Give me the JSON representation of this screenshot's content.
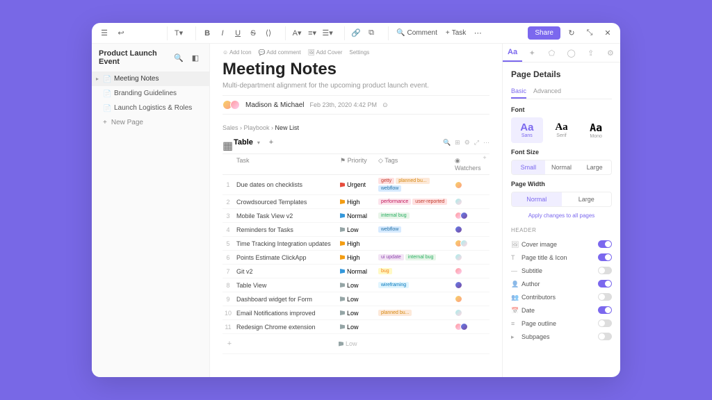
{
  "sidebar": {
    "title": "Product Launch Event",
    "items": [
      {
        "label": "Meeting Notes",
        "active": true
      },
      {
        "label": "Branding Guidelines",
        "active": false
      },
      {
        "label": "Launch Logistics & Roles",
        "active": false
      }
    ],
    "newPage": "New Page"
  },
  "metaActions": {
    "addIcon": "Add Icon",
    "addComment": "Add comment",
    "addCover": "Add Cover",
    "settings": "Settings"
  },
  "page": {
    "title": "Meeting Notes",
    "subtitle": "Multi-department alignment for the upcoming product launch event.",
    "author": "Madison & Michael",
    "date": "Feb 23th, 2020  4:42 PM"
  },
  "breadcrumb": {
    "p1": "Sales",
    "p2": "Playbook",
    "cur": "New List"
  },
  "table": {
    "name": "Table",
    "columns": {
      "task": "Task",
      "priority": "Priority",
      "tags": "Tags",
      "watchers": "Watchers"
    },
    "rows": [
      {
        "n": "1",
        "task": "Due dates on checklists",
        "priority": "Urgent",
        "pclass": "urgent",
        "tags": [
          [
            "getty",
            "getty"
          ],
          [
            "planned",
            "planned bu..."
          ],
          [
            "webflow",
            "webflow"
          ]
        ],
        "w": 1
      },
      {
        "n": "2",
        "task": "Crowdsourced Templates",
        "priority": "High",
        "pclass": "high",
        "tags": [
          [
            "perf",
            "performance"
          ],
          [
            "user-rep",
            "user-reported"
          ]
        ],
        "w": 1
      },
      {
        "n": "3",
        "task": "Mobile Task View v2",
        "priority": "Normal",
        "pclass": "normal",
        "tags": [
          [
            "intbug",
            "internal bug"
          ]
        ],
        "w": 2
      },
      {
        "n": "4",
        "task": "Reminders for Tasks",
        "priority": "Low",
        "pclass": "low",
        "tags": [
          [
            "webflow",
            "webflow"
          ]
        ],
        "w": 1
      },
      {
        "n": "5",
        "task": "Time Tracking Integration updates",
        "priority": "High",
        "pclass": "high",
        "tags": [],
        "w": 2
      },
      {
        "n": "6",
        "task": "Points Estimate ClickApp",
        "priority": "High",
        "pclass": "high",
        "tags": [
          [
            "uiup",
            "ui update"
          ],
          [
            "intbug",
            "internal bug"
          ]
        ],
        "w": 1
      },
      {
        "n": "7",
        "task": "Git v2",
        "priority": "Normal",
        "pclass": "normal",
        "tags": [
          [
            "bug",
            "bug"
          ]
        ],
        "w": 1
      },
      {
        "n": "8",
        "task": "Table View",
        "priority": "Low",
        "pclass": "low",
        "tags": [
          [
            "wf",
            "wireframing"
          ]
        ],
        "w": 1
      },
      {
        "n": "9",
        "task": "Dashboard widget for Form",
        "priority": "Low",
        "pclass": "low",
        "tags": [],
        "w": 1
      },
      {
        "n": "10",
        "task": "Email Notifications improved",
        "priority": "Low",
        "pclass": "low",
        "tags": [
          [
            "planned",
            "planned bu..."
          ]
        ],
        "w": 1
      },
      {
        "n": "11",
        "task": "Redesign Chrome extension",
        "priority": "Low",
        "pclass": "low",
        "tags": [],
        "w": 2
      },
      {
        "n": "",
        "task": "",
        "priority": "Low",
        "pclass": "low",
        "tags": [],
        "w": 0
      }
    ]
  },
  "topbar": {
    "comment": "Comment",
    "task": "Task",
    "share": "Share"
  },
  "panel": {
    "title": "Page Details",
    "tabs": {
      "basic": "Basic",
      "advanced": "Advanced"
    },
    "font": {
      "label": "Font",
      "sans": "Sans",
      "serif": "Serif",
      "mono": "Mono"
    },
    "fontSize": {
      "label": "Font Size",
      "small": "Small",
      "normal": "Normal",
      "large": "Large"
    },
    "pageWidth": {
      "label": "Page Width",
      "normal": "Normal",
      "large": "Large"
    },
    "applyAll": "Apply changes to all pages",
    "header": "HEADER",
    "toggles": [
      {
        "label": "Cover image",
        "on": true
      },
      {
        "label": "Page title & Icon",
        "on": true
      },
      {
        "label": "Subtitle",
        "on": false
      },
      {
        "label": "Author",
        "on": true
      },
      {
        "label": "Contributors",
        "on": false
      },
      {
        "label": "Date",
        "on": true
      },
      {
        "label": "Page outline",
        "on": false
      },
      {
        "label": "Subpages",
        "on": false
      }
    ]
  }
}
